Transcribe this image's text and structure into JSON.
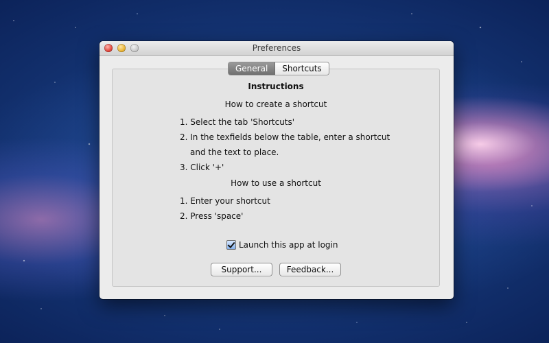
{
  "window": {
    "title": "Preferences"
  },
  "tabs": [
    {
      "label": "General",
      "active": true
    },
    {
      "label": "Shortcuts",
      "active": false
    }
  ],
  "instructions": {
    "heading": "Instructions",
    "create_title": "How to create a shortcut",
    "create_steps": [
      "1. Select the tab 'Shortcuts'",
      "2. In the texfields below the table, enter a shortcut",
      "and the text to place.",
      "3. Click '+'"
    ],
    "use_title": "How to use a shortcut",
    "use_steps": [
      "1. Enter your shortcut",
      "2. Press 'space'"
    ]
  },
  "launch_at_login": {
    "label": "Launch this app at login",
    "checked": true
  },
  "buttons": {
    "support": "Support...",
    "feedback": "Feedback..."
  },
  "colors": {
    "window_background": "#ececec",
    "panel_background": "#e4e4e4",
    "active_tab": "#7f7f7f",
    "desktop": "#1f4b96"
  }
}
